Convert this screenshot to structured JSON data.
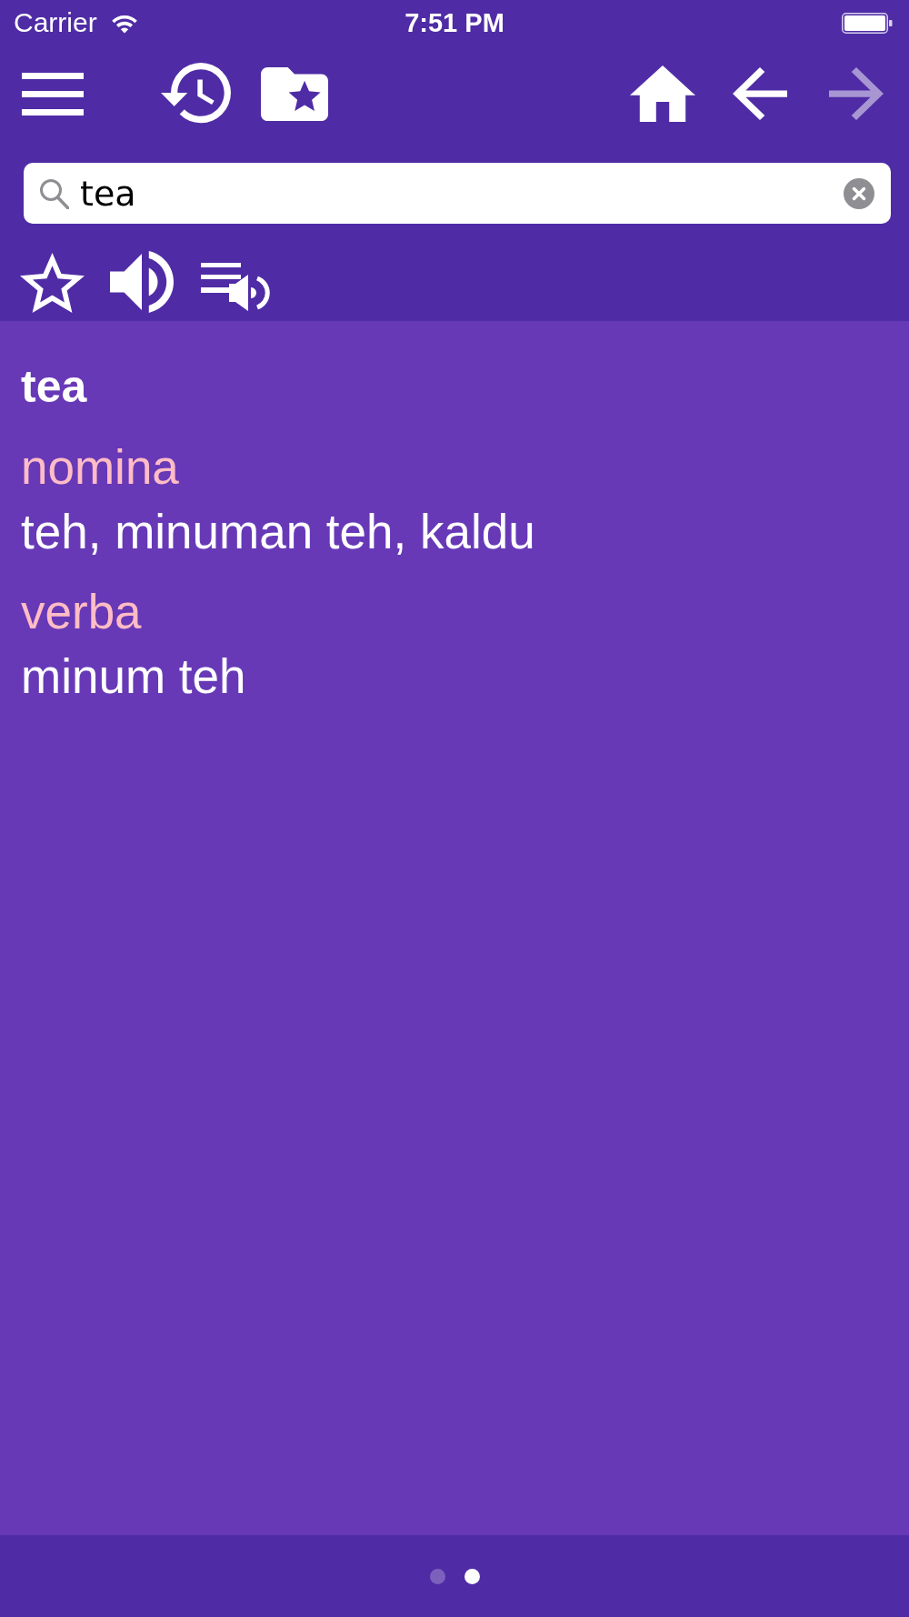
{
  "status_bar": {
    "carrier": "Carrier",
    "time": "7:51 PM"
  },
  "toolbar": {
    "left": [
      {
        "kind": "menu",
        "disabled": false
      },
      {
        "kind": "history",
        "disabled": false
      },
      {
        "kind": "favorites",
        "disabled": false
      }
    ],
    "right": [
      {
        "kind": "home",
        "disabled": false
      },
      {
        "kind": "back",
        "disabled": false
      },
      {
        "kind": "forward",
        "disabled": true
      }
    ]
  },
  "search": {
    "value": "tea"
  },
  "entry": {
    "headword": "tea",
    "senses": [
      {
        "part_of_speech": "nomina",
        "translation": "teh, minuman teh, kaldu"
      },
      {
        "part_of_speech": "verba",
        "translation": "minum teh"
      }
    ]
  },
  "pager": {
    "pages": [
      {
        "selected": false
      },
      {
        "selected": true
      }
    ]
  }
}
